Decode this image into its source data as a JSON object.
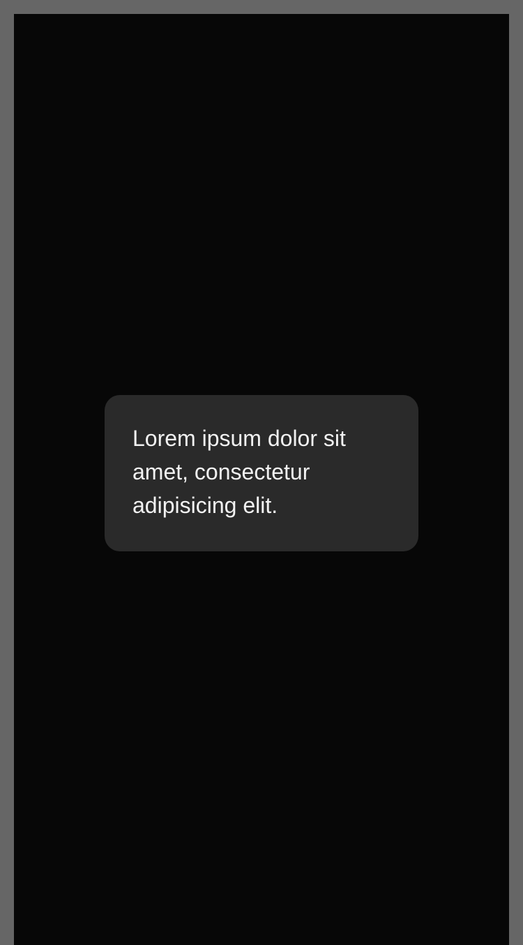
{
  "colors": {
    "backdrop": "#666666",
    "screen_background": "#070707",
    "toast_background": "#2a2a2a",
    "toast_text": "#f2f2f2"
  },
  "toast": {
    "message": "Lorem ipsum dolor sit amet, consectetur adipisicing elit."
  }
}
